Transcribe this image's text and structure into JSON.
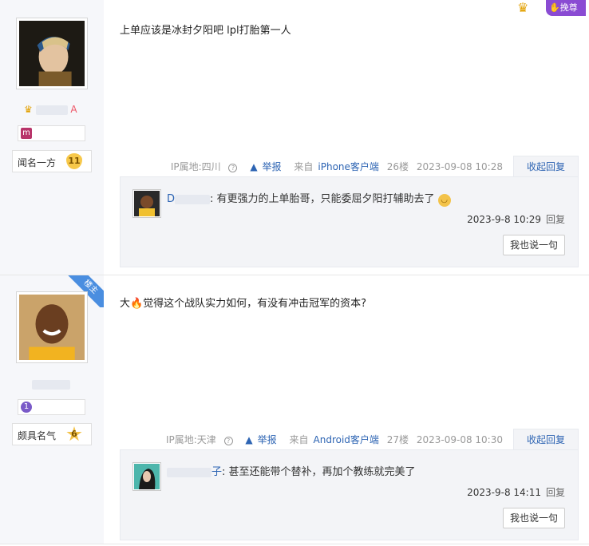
{
  "vip": {
    "label": "挽尊"
  },
  "posts": [
    {
      "content": "上单应该是冰封夕阳吧 lpl打胎第一人",
      "user_name_visible": "A",
      "level": {
        "title": "闻名一方",
        "num": "11"
      },
      "meta": {
        "ip": "IP属地:四川",
        "report": "举报",
        "client_prefix": "来自",
        "client": "iPhone客户端",
        "floor": "26楼",
        "time": "2023-09-08 10:28",
        "collapse": "收起回复"
      },
      "reply": {
        "name_suffix": "",
        "text": ": 有更强力的上单胎哥，只能委屈夕阳打辅助去了",
        "time": "2023-9-8 10:29",
        "reply_btn": "回复",
        "say": "我也说一句"
      }
    },
    {
      "content": "大🔥觉得这个战队实力如何，有没有冲击冠军的资本?",
      "ribbon": "楼主",
      "level": {
        "title": "颇具名气",
        "num": "6"
      },
      "meta": {
        "ip": "IP属地:天津",
        "report": "举报",
        "client_prefix": "来自",
        "client": "Android客户端",
        "floor": "27楼",
        "time": "2023-09-08 10:30",
        "collapse": "收起回复"
      },
      "reply": {
        "name_suffix": "子",
        "text": ": 甚至还能带个替补，再加个教练就完美了",
        "time": "2023-9-8 14:11",
        "reply_btn": "回复",
        "say": "我也说一句"
      }
    }
  ]
}
